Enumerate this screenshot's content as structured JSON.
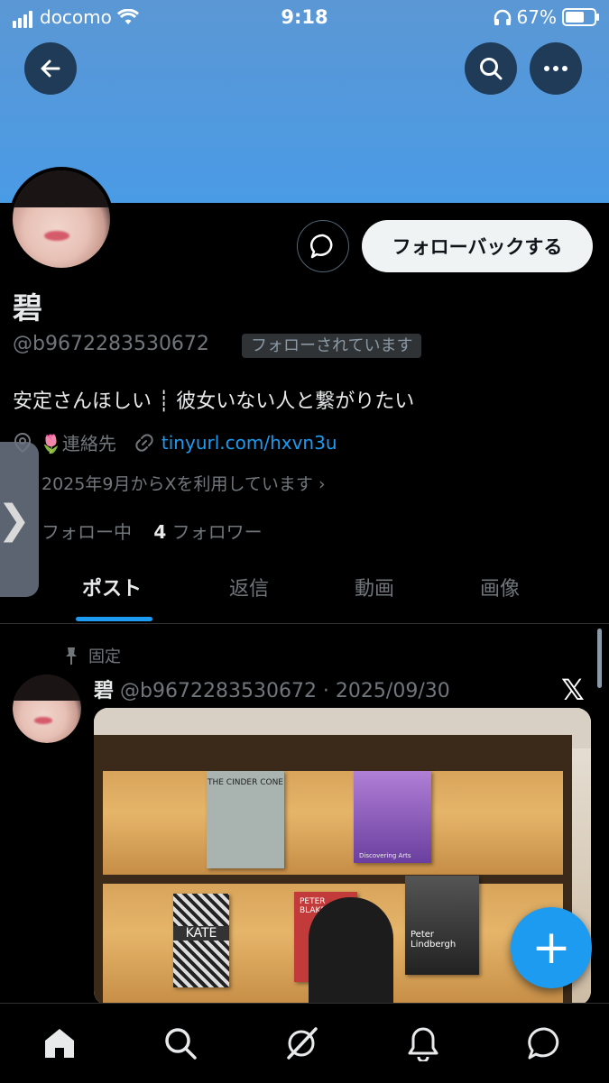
{
  "status_bar": {
    "carrier": "docomo",
    "time": "9:18",
    "battery": "67%"
  },
  "header": {
    "back_icon": "back-arrow-icon",
    "search_icon": "search-icon",
    "more_icon": "more-dots-icon",
    "banner_color": "#4a9be6"
  },
  "profile": {
    "name": "碧",
    "handle": "@b9672283530672",
    "follows_you": "フォローされています",
    "follow_back_label": "フォローバックする",
    "bio": "安定さんほしい ┊ 彼女いない人と繋がりたい",
    "location": "🌷連絡先",
    "link": "tinyurl.com/hxvn3u",
    "joined": "2025年9月からXを利用しています",
    "following_label": "フォロー中",
    "followers_count": "4",
    "followers_label": "フォロワー"
  },
  "tabs": [
    {
      "label": "ポスト",
      "active": true
    },
    {
      "label": "返信"
    },
    {
      "label": "動画"
    },
    {
      "label": "画像"
    }
  ],
  "post": {
    "pinned_label": "固定",
    "author": "碧",
    "handle_date": "@b9672283530672 · 2025/09/30",
    "book_titles": [
      "THE CINDER CONE",
      "Discovering Arts",
      "KATE",
      "PETER BLAKE",
      "Peter Lindbergh"
    ]
  },
  "fab_label": "+",
  "bottom_nav": [
    "home-icon",
    "search-icon",
    "grok-icon",
    "notifications-icon",
    "messages-icon"
  ]
}
